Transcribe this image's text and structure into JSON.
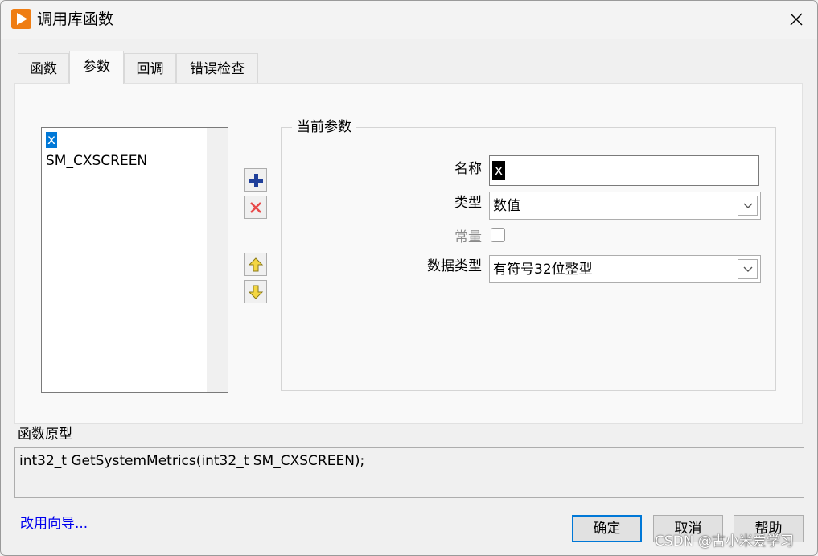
{
  "window": {
    "title": "调用库函数"
  },
  "tabs": [
    {
      "label": "函数"
    },
    {
      "label": "参数"
    },
    {
      "label": "回调"
    },
    {
      "label": "错误检查"
    }
  ],
  "param_list": {
    "items": [
      "x",
      "SM_CXSCREEN"
    ],
    "selected": "x"
  },
  "current_param": {
    "group_title": "当前参数",
    "name_label": "名称",
    "name_value": "x",
    "type_label": "类型",
    "type_value": "数值",
    "const_label": "常量",
    "const_checked": false,
    "datatype_label": "数据类型",
    "datatype_value": "有符号32位整型"
  },
  "prototype": {
    "label": "函数原型",
    "value": "int32_t GetSystemMetrics(int32_t SM_CXSCREEN);"
  },
  "footer": {
    "wizard_link": "改用向导...",
    "ok_label": "确定",
    "cancel_label": "取消",
    "help_label": "帮助"
  },
  "watermark": "CSDN @古小米爱学习",
  "colors": {
    "accent": "#0078d7",
    "app_icon": "#ef7d13",
    "add_icon": "#1f3f9a",
    "delete_icon": "#e84a4a",
    "arrow_icon": "#e8c21a"
  }
}
